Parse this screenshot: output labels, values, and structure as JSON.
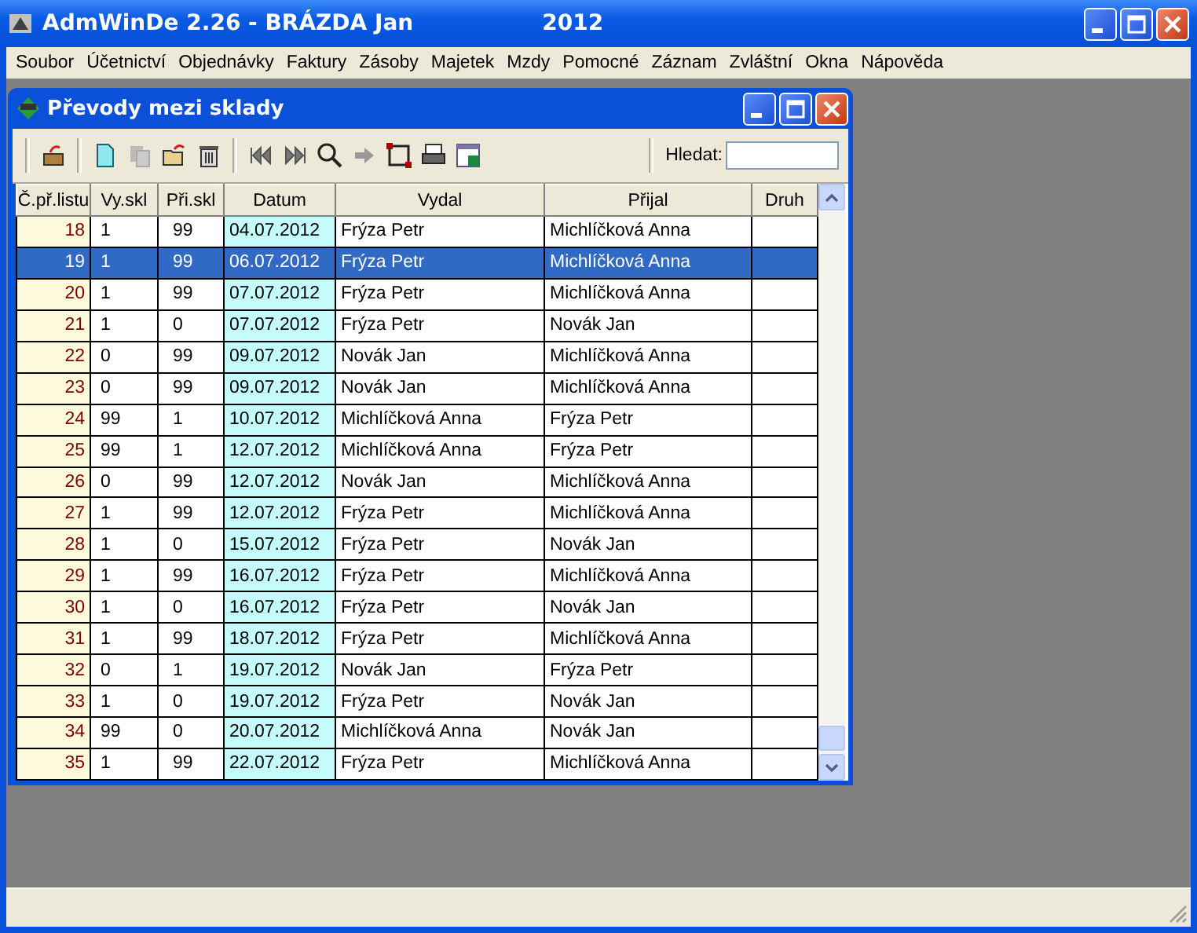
{
  "window": {
    "title": "AdmWinDe 2.26 - BRÁZDA Jan",
    "year": "2012"
  },
  "menu": [
    "Soubor",
    "Účetnictví",
    "Objednávky",
    "Faktury",
    "Zásoby",
    "Majetek",
    "Mzdy",
    "Pomocné",
    "Záznam",
    "Zvláštní",
    "Okna",
    "Nápověda"
  ],
  "child": {
    "title": "Převody mezi sklady",
    "search": {
      "label": "Hledat:"
    }
  },
  "table": {
    "columns": [
      "Č.př.listu",
      "Vy.skl",
      "Při.skl",
      "Datum",
      "Vydal",
      "Přijal",
      "Druh"
    ],
    "rows": [
      {
        "selected": false,
        "cells": [
          "18",
          "1",
          "99",
          "04.07.2012",
          "Frýza Petr",
          "Michlíčková Anna",
          ""
        ]
      },
      {
        "selected": true,
        "cells": [
          "19",
          "1",
          "99",
          "06.07.2012",
          "Frýza Petr",
          "Michlíčková Anna",
          ""
        ]
      },
      {
        "selected": false,
        "cells": [
          "20",
          "1",
          "99",
          "07.07.2012",
          "Frýza Petr",
          "Michlíčková Anna",
          ""
        ]
      },
      {
        "selected": false,
        "cells": [
          "21",
          "1",
          "0",
          "07.07.2012",
          "Frýza Petr",
          "Novák Jan",
          ""
        ]
      },
      {
        "selected": false,
        "cells": [
          "22",
          "0",
          "99",
          "09.07.2012",
          "Novák Jan",
          "Michlíčková Anna",
          ""
        ]
      },
      {
        "selected": false,
        "cells": [
          "23",
          "0",
          "99",
          "09.07.2012",
          "Novák Jan",
          "Michlíčková Anna",
          ""
        ]
      },
      {
        "selected": false,
        "cells": [
          "24",
          "99",
          "1",
          "10.07.2012",
          "Michlíčková Anna",
          "Frýza Petr",
          ""
        ]
      },
      {
        "selected": false,
        "cells": [
          "25",
          "99",
          "1",
          "12.07.2012",
          "Michlíčková Anna",
          "Frýza Petr",
          ""
        ]
      },
      {
        "selected": false,
        "cells": [
          "26",
          "0",
          "99",
          "12.07.2012",
          "Novák Jan",
          "Michlíčková Anna",
          ""
        ]
      },
      {
        "selected": false,
        "cells": [
          "27",
          "1",
          "99",
          "12.07.2012",
          "Frýza Petr",
          "Michlíčková Anna",
          ""
        ]
      },
      {
        "selected": false,
        "cells": [
          "28",
          "1",
          "0",
          "15.07.2012",
          "Frýza Petr",
          "Novák Jan",
          ""
        ]
      },
      {
        "selected": false,
        "cells": [
          "29",
          "1",
          "99",
          "16.07.2012",
          "Frýza Petr",
          "Michlíčková Anna",
          ""
        ]
      },
      {
        "selected": false,
        "cells": [
          "30",
          "1",
          "0",
          "16.07.2012",
          "Frýza Petr",
          "Novák Jan",
          ""
        ]
      },
      {
        "selected": false,
        "cells": [
          "31",
          "1",
          "99",
          "18.07.2012",
          "Frýza Petr",
          "Michlíčková Anna",
          ""
        ]
      },
      {
        "selected": false,
        "cells": [
          "32",
          "0",
          "1",
          "19.07.2012",
          "Novák Jan",
          "Frýza Petr",
          ""
        ]
      },
      {
        "selected": false,
        "cells": [
          "33",
          "1",
          "0",
          "19.07.2012",
          "Frýza Petr",
          "Novák Jan",
          ""
        ]
      },
      {
        "selected": false,
        "cells": [
          "34",
          "99",
          "0",
          "20.07.2012",
          "Michlíčková Anna",
          "Novák Jan",
          ""
        ]
      },
      {
        "selected": false,
        "cells": [
          "35",
          "1",
          "99",
          "22.07.2012",
          "Frýza Petr",
          "Michlíčková Anna",
          ""
        ]
      }
    ]
  }
}
